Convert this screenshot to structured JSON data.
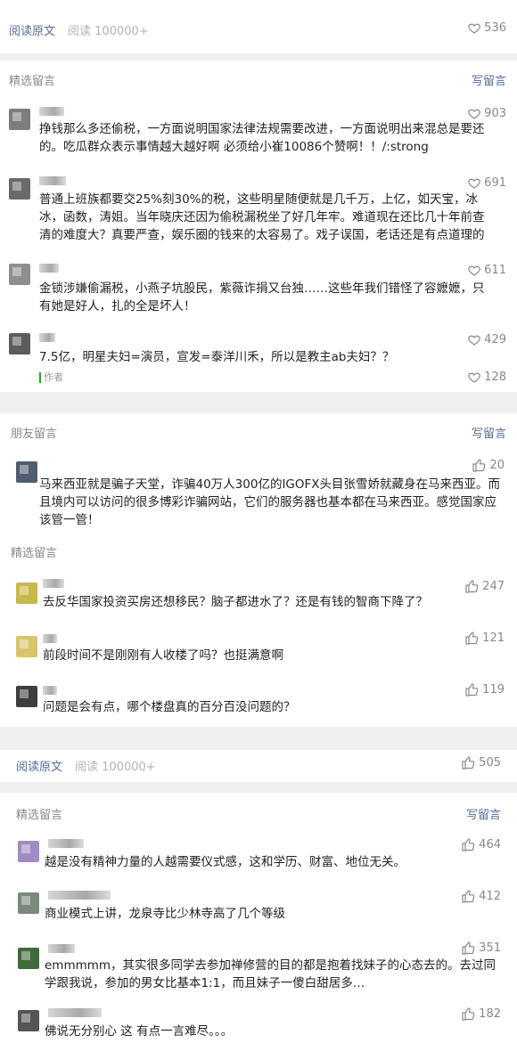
{
  "panel1": {
    "read_original": "阅读原文",
    "read_count": "阅读 100000+",
    "likes": "536",
    "section": "精选留言",
    "write": "写留言",
    "comments": [
      {
        "text": "挣钱那么多还偷税，一方面说明国家法律法规需要改进，一方面说明出来混总是要还的。吃瓜群众表示事情越大越好啊 必须给小崔10086个赞啊！！/:strong",
        "likes": "903"
      },
      {
        "text": "普通上班族都要交25%刻30%的税，这些明星随便就是几千万，上亿，如天宝，冰冰，函数，涛姐。当年晓庆还因为偷税漏税坐了好几年牢。难道现在还比几十年前查清的难度大？真要严查，娱乐圈的钱来的太容易了。戏子误国，老话还是有点道理的",
        "likes": "691"
      },
      {
        "text": "金锁涉嫌偷漏税，小燕子坑股民，紫薇诈捐又台独……这些年我们错怪了容嬷嬷，只有她是好人，扎的全是坏人！",
        "likes": "611"
      },
      {
        "text": "7.5亿，明星夫妇=演员，宣发=泰洋川禾，所以是教主ab夫妇？？",
        "likes": "429"
      }
    ],
    "author_tag": "作者",
    "author_likes": "128"
  },
  "panel2": {
    "section": "朋友留言",
    "write": "写留言",
    "friend_comment": {
      "text": "马来西亚就是骗子天堂，诈骗40万人300亿的IGOFX头目张雪娇就藏身在马来西亚。而且境内可以访问的很多博彩诈骗网站，它们的服务器也基本都在马来西亚。感觉国家应该管一管！",
      "likes": "20"
    },
    "section2": "精选留言",
    "comments": [
      {
        "text": "去反华国家投资买房还想移民？脑子都进水了？还是有钱的智商下降了？",
        "likes": "247"
      },
      {
        "text": "前段时间不是刚刚有人收楼了吗？也挺满意啊",
        "likes": "121"
      },
      {
        "text": "问题是会有点，哪个楼盘真的百分百没问题的？",
        "likes": "119"
      }
    ]
  },
  "panel3": {
    "read_original": "阅读原文",
    "read_count": "阅读 100000+",
    "likes": "505",
    "section": "精选留言",
    "write": "写留言",
    "comments": [
      {
        "text": "越是没有精神力量的人越需要仪式感，这和学历、财富、地位无关。",
        "likes": "464"
      },
      {
        "text": "商业模式上讲，龙泉寺比少林寺高了几个等级",
        "likes": "412"
      },
      {
        "text": "emmmmm，其实很多同学去参加禅修营的目的都是抱着找妹子的心态去的。去过同学跟我说，参加的男女比基本1:1，而且妹子一傻白甜居多…",
        "likes": "351"
      },
      {
        "text": "佛说无分别心 这 有点一言难尽。。。",
        "likes": "182"
      }
    ]
  }
}
